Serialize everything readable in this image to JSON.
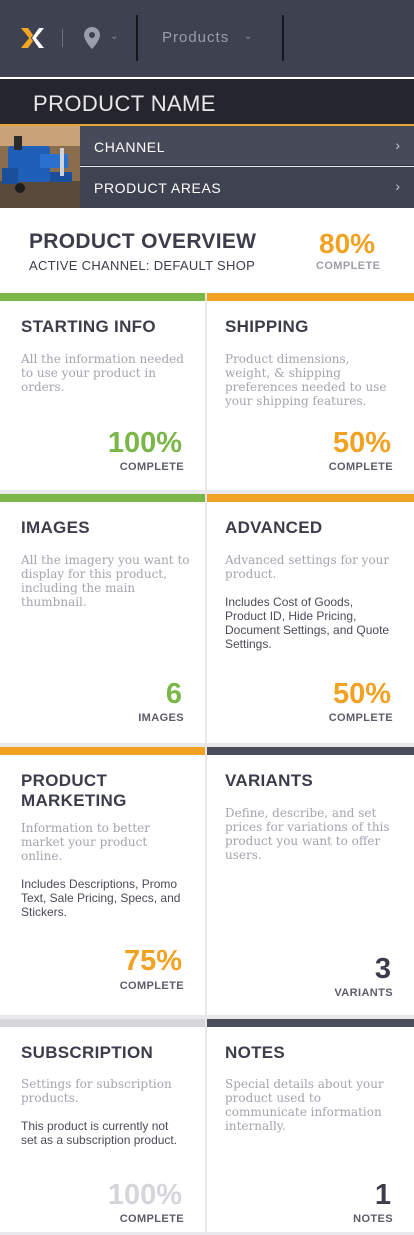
{
  "header": {
    "products_menu_label": "Products"
  },
  "product": {
    "name": "PRODUCT NAME"
  },
  "nav": {
    "channel_label": "CHANNEL",
    "areas_label": "PRODUCT AREAS"
  },
  "overview": {
    "title": "PRODUCT OVERVIEW",
    "active_channel": "ACTIVE CHANNEL: DEFAULT SHOP",
    "percent": "80%",
    "complete_label": "COMPLETE"
  },
  "colors": {
    "green": "#7ab648",
    "orange": "#f2a223",
    "dark": "#4a4d5a",
    "light_gray": "#d5d5da",
    "gray_text": "#d6d6da"
  },
  "cards": [
    {
      "title": "STARTING INFO",
      "desc": "All the information needed to use your product in orders.",
      "extra": "",
      "value": "100%",
      "unit": "COMPLETE"
    },
    {
      "title": "SHIPPING",
      "desc": "Product dimensions, weight, & shipping preferences needed to use your shipping features.",
      "extra": "",
      "value": "50%",
      "unit": "COMPLETE"
    },
    {
      "title": "IMAGES",
      "desc": "All the imagery you want to display for this product, including the main thumbnail.",
      "extra": "",
      "value": "6",
      "unit": "IMAGES"
    },
    {
      "title": "ADVANCED",
      "desc": "Advanced settings for your product.",
      "extra": "Includes Cost of Goods, Product ID, Hide Pricing, Document Settings, and Quote Settings.",
      "value": "50%",
      "unit": "COMPLETE"
    },
    {
      "title": "PRODUCT MARKETING",
      "desc": "Information to better market your product online.",
      "extra": "Includes Descriptions, Promo Text, Sale Pricing, Specs, and Stickers.",
      "value": "75%",
      "unit": "COMPLETE"
    },
    {
      "title": "VARIANTS",
      "desc": "Define, describe, and set prices for variations of this product you want to offer users.",
      "extra": "",
      "value": "3",
      "unit": "VARIANTS"
    },
    {
      "title": "SUBSCRIPTION",
      "desc": "Settings for subscription products.",
      "extra": "This product is currently not set as a subscription product.",
      "value": "100%",
      "unit": "COMPLETE"
    },
    {
      "title": "NOTES",
      "desc": "Special details about your product used to communicate information internally.",
      "extra": "",
      "value": "1",
      "unit": "NOTES"
    }
  ]
}
